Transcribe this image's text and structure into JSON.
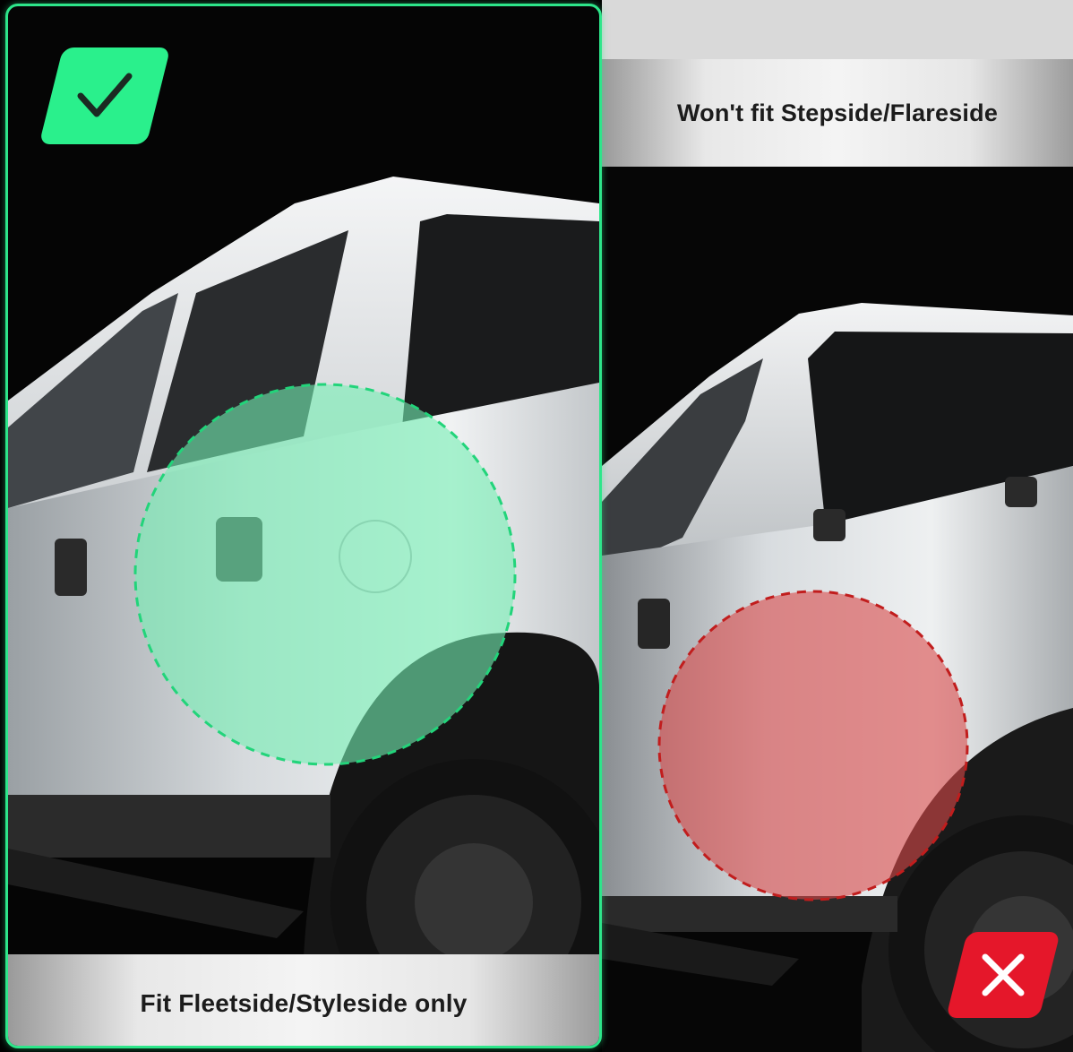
{
  "left_panel": {
    "label": "Fit Fleetside/Styleside only",
    "badge_icon": "check-icon",
    "accent_color": "#2de68a",
    "highlight_color": "#74f0b4"
  },
  "right_panel": {
    "label": "Won't fit Stepside/Flareside",
    "badge_icon": "x-icon",
    "accent_color": "#e5172a",
    "highlight_color": "#d84a4a"
  }
}
